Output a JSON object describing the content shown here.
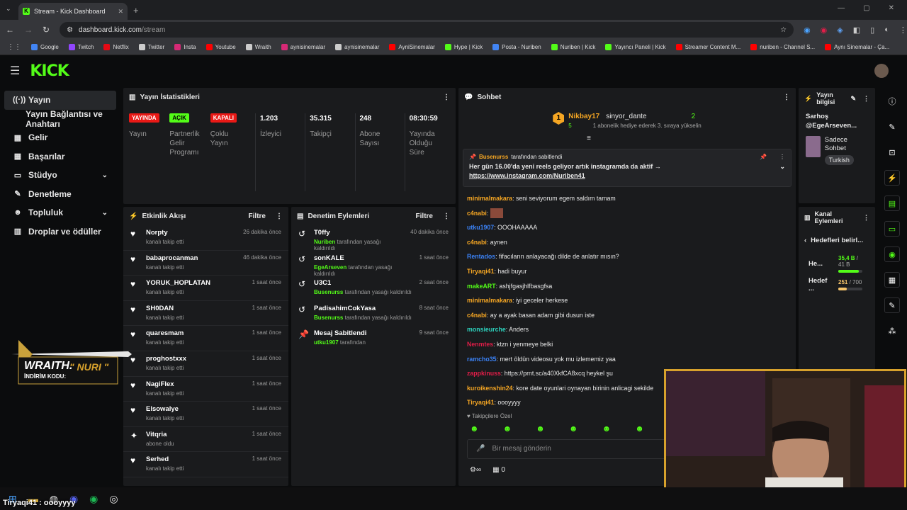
{
  "browser": {
    "tab_title": "Stream - Kick Dashboard",
    "url_host": "dashboard.kick.com",
    "url_path": "/stream",
    "bookmarks": [
      {
        "label": "Google",
        "color": "#4285f4"
      },
      {
        "label": "Twitch",
        "color": "#9146ff"
      },
      {
        "label": "Netflix",
        "color": "#e50914"
      },
      {
        "label": "Twitter",
        "color": "#cccccc"
      },
      {
        "label": "Insta",
        "color": "#d62976"
      },
      {
        "label": "Youtube",
        "color": "#ff0000"
      },
      {
        "label": "Wraith",
        "color": "#cccccc"
      },
      {
        "label": "aynisinemalar",
        "color": "#d62976"
      },
      {
        "label": "aynisinemalar",
        "color": "#cccccc"
      },
      {
        "label": "AyniSinemalar",
        "color": "#ff0000"
      },
      {
        "label": "Hype | Kick",
        "color": "#53fc18"
      },
      {
        "label": "Posta - Nuriben",
        "color": "#4285f4"
      },
      {
        "label": "Nuriben | Kick",
        "color": "#53fc18"
      },
      {
        "label": "Yayıncı Paneli | Kick",
        "color": "#53fc18"
      },
      {
        "label": "Streamer Content M...",
        "color": "#ff0000"
      },
      {
        "label": "nuriben - Channel S...",
        "color": "#ff0000"
      },
      {
        "label": "Aynı Sinemalar - Ça...",
        "color": "#ff0000"
      }
    ]
  },
  "sidebar": {
    "items": [
      {
        "label": "Yayın",
        "icon": "((·))",
        "active": true
      },
      {
        "label": "Yayın Bağlantısı ve Anahtarı",
        "icon": ""
      },
      {
        "label": "Gelir",
        "icon": "▦"
      },
      {
        "label": "Başarılar",
        "icon": "▦"
      },
      {
        "label": "Stüdyo",
        "icon": "▭",
        "chevron": true
      },
      {
        "label": "Denetleme",
        "icon": "✎"
      },
      {
        "label": "Topluluk",
        "icon": "☻",
        "chevron": true
      },
      {
        "label": "Droplar ve ödüller",
        "icon": "▥"
      }
    ]
  },
  "stats": {
    "title": "Yayın İstatistikleri",
    "cards": [
      {
        "badge": "YAYINDA",
        "badge_style": "red",
        "label": "Yayın"
      },
      {
        "badge": "AÇIK",
        "badge_style": "green",
        "label": "Partnerlik Gelir Programı"
      },
      {
        "badge": "KAPALI",
        "badge_style": "red",
        "label": "Çoklu Yayın"
      },
      {
        "num": "1.203",
        "label": "İzleyici"
      },
      {
        "num": "35.315",
        "label": "Takipçi"
      },
      {
        "num": "248",
        "label": "Abone Sayısı"
      },
      {
        "num": "08:30:59",
        "label": "Yayında Olduğu Süre"
      }
    ]
  },
  "activity": {
    "title": "Etkinlik Akışı",
    "filter": "Filtre",
    "items": [
      {
        "name": "Norpty",
        "sub": "kanalı takip etti",
        "time": "26 dakika önce",
        "icon": "♥"
      },
      {
        "name": "babaprocanman",
        "sub": "kanalı takip etti",
        "time": "46 dakika önce",
        "icon": "♥"
      },
      {
        "name": "YORUK_HOPLATAN",
        "sub": "kanalı takip etti",
        "time": "1 saat önce",
        "icon": "♥"
      },
      {
        "name": "SH0DAN",
        "sub": "kanalı takip etti",
        "time": "1 saat önce",
        "icon": "♥"
      },
      {
        "name": "quaresmam",
        "sub": "kanalı takip etti",
        "time": "1 saat önce",
        "icon": "♥"
      },
      {
        "name": "proghostxxx",
        "sub": "kanalı takip etti",
        "time": "1 saat önce",
        "icon": "♥"
      },
      {
        "name": "NagiFlex",
        "sub": "kanalı takip etti",
        "time": "1 saat önce",
        "icon": "♥"
      },
      {
        "name": "Elsowalye",
        "sub": "kanalı takip etti",
        "time": "1 saat önce",
        "icon": "♥"
      },
      {
        "name": "Vitqria",
        "sub": "abone oldu",
        "time": "1 saat önce",
        "icon": "✦"
      },
      {
        "name": "Serhed",
        "sub": "kanalı takip etti",
        "time": "1 saat önce",
        "icon": "♥"
      }
    ]
  },
  "moderation": {
    "title": "Denetim Eylemleri",
    "filter": "Filtre",
    "items": [
      {
        "name": "T0ffy",
        "actor": "Nuriben",
        "sub": "tarafından yasağı kaldırıldı",
        "time": "40 dakika önce",
        "icon": "↺"
      },
      {
        "name": "sonKALE",
        "actor": "EgeArseven",
        "sub": "tarafından yasağı kaldırıldı",
        "time": "1 saat önce",
        "icon": "↺"
      },
      {
        "name": "U3C1",
        "actor": "Busenurss",
        "sub": "tarafından yasağı kaldırıldı",
        "time": "2 saat önce",
        "icon": "↺"
      },
      {
        "name": "PadisahimCokYasa",
        "actor": "Busenurss",
        "sub": "tarafından yasağı kaldırıldı",
        "time": "8 saat önce",
        "icon": "↺"
      },
      {
        "name": "Mesaj Sabitlendi",
        "actor": "utku1907",
        "sub": "tarafından",
        "time": "9 saat önce",
        "icon": "📌"
      }
    ]
  },
  "chat": {
    "title": "Sohbet",
    "gift": {
      "user": "Nikbay17",
      "count": "5",
      "rank_user": "sinyor_dante",
      "rank_count": "2",
      "line": "1 abonelik hediye ederek 3. sıraya yükselin"
    },
    "pinned": {
      "by": "Busenurss",
      "by_suffix": "tarafından sabitlendi",
      "text": "Her gün 16.00'da yeni reels geliyor artık instagramda da aktif →",
      "link": "https://www.instagram.com/Nuriben41"
    },
    "messages": [
      {
        "user": "minimalmakara",
        "color": "#f5a623",
        "text": "seni seviyorum egem saldım tamam"
      },
      {
        "user": "c4nabi",
        "color": "#f5a623",
        "text": "[emote]"
      },
      {
        "user": "utku1907",
        "color": "#3b82f6",
        "text": "OOOHAAAAA"
      },
      {
        "user": "c4nabi",
        "color": "#f5a623",
        "text": "aynen"
      },
      {
        "user": "Rentados",
        "color": "#3b82f6",
        "text": "fifacıların anlayacağı dilde de anlatır mısın?"
      },
      {
        "user": "Tiryaqi41",
        "color": "#f5a623",
        "text": "hadi buyur"
      },
      {
        "user": "makeART",
        "color": "#53fc18",
        "text": "ashjfgasjhlfbasgfsa"
      },
      {
        "user": "minimalmakara",
        "color": "#f5a623",
        "text": "iyi geceler herkese"
      },
      {
        "user": "c4nabi",
        "color": "#f5a623",
        "text": "ay a ayak basan adam gibi dusun iste"
      },
      {
        "user": "monsieurche",
        "color": "#2dd4bf",
        "text": "Anders"
      },
      {
        "user": "Nenmtes",
        "color": "#e11d48",
        "text": "ktzn i yenmeye belki"
      },
      {
        "user": "ramcho35",
        "color": "#3b82f6",
        "text": "mert öldün videosu yok mu izlememiz yaa"
      },
      {
        "user": "zappkinuss",
        "color": "#e11d48",
        "text": "https://prnt.sc/a40XkfCA8xcq heykel şu"
      },
      {
        "user": "kuroikenshin24",
        "color": "#f5a623",
        "text": "kore date oyunlari oynayan birinin anlicagi sekilde"
      },
      {
        "user": "Tiryaqi41",
        "color": "#f5a623",
        "text": "oooyyyy"
      }
    ],
    "followers_only": "Takipçilere Özel",
    "placeholder": "Bir mesaj gönderin",
    "points": "0"
  },
  "stream_info": {
    "title": "Yayın bilgisi",
    "stream_title": "Sarhoş @EgeArseven...",
    "category": "Sadece Sohbet",
    "language": "Turkish"
  },
  "channel_actions": {
    "title": "Kanal Eylemleri",
    "goals_title": "Hedefleri belirl...",
    "goals": [
      {
        "label": "He...",
        "value": "35,4 B",
        "total": "41 B",
        "fraction": 0.86,
        "color": "#53fc18"
      },
      {
        "label": "Hedef ...",
        "value": "251",
        "total": "700",
        "fraction": 0.36,
        "color": "#f5c46b"
      }
    ]
  },
  "overlay": {
    "promo_brand": "WRAITH.",
    "promo_code_label": "İNDİRİM KODU:",
    "promo_code": "\" NURI \"",
    "ticker": "Tiryaqi41 : oooyyyy"
  }
}
